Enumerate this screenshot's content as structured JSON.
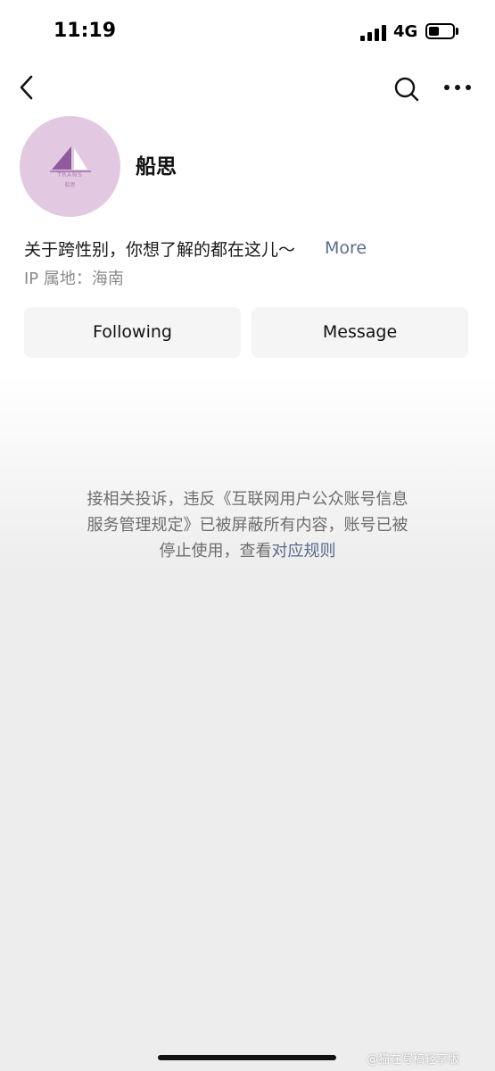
{
  "status_bar": {
    "time": "11:19",
    "network": "4G"
  },
  "profile": {
    "name": "船思",
    "logo_text": "TRANS",
    "logo_subtext": "船思",
    "bio": "关于跨性别，你想了解的都在这儿～",
    "bio_more": "More",
    "ip_location": "IP 属地：海南"
  },
  "actions": {
    "following_label": "Following",
    "message_label": "Message"
  },
  "notice": {
    "line1": "接相关投诉，违反《互联网用户公众账号信息",
    "line2": "服务管理规定》已被屏蔽所有内容，账号已被",
    "line3_prefix": "停止使用，查看",
    "link": "对应规则"
  },
  "watermark": "@猫在写稿轻享版"
}
